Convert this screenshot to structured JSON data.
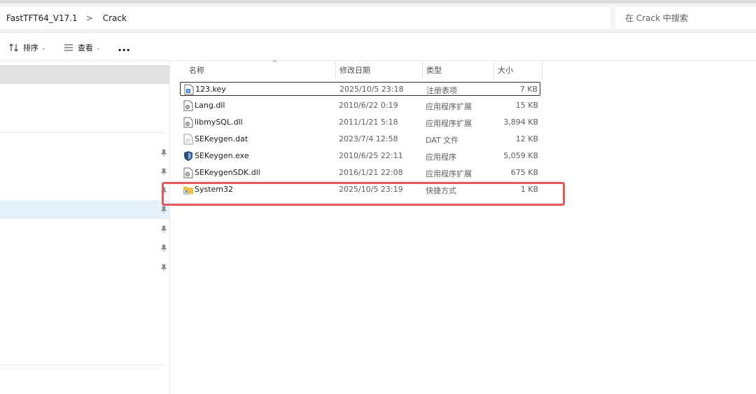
{
  "address": {
    "breadcrumb": [
      "FastTFT64_V17.1",
      "Crack"
    ],
    "separator": ">",
    "search_placeholder": "在 Crack 中搜索"
  },
  "toolbar": {
    "sort_label": "排序",
    "view_label": "查看",
    "more_label": "..."
  },
  "columns": {
    "name": "名称",
    "date": "修改日期",
    "type": "类型",
    "size": "大小"
  },
  "files": [
    {
      "name": "123.key",
      "date": "2025/10/5 23:18",
      "type": "注册表项",
      "size": "7 KB",
      "icon": "registry-file-icon"
    },
    {
      "name": "Lang.dll",
      "date": "2010/6/22 0:19",
      "type": "应用程序扩展",
      "size": "15 KB",
      "icon": "dll-file-icon"
    },
    {
      "name": "libmySQL.dll",
      "date": "2011/1/21 5:18",
      "type": "应用程序扩展",
      "size": "3,894 KB",
      "icon": "dll-file-icon"
    },
    {
      "name": "SEKeygen.dat",
      "date": "2023/7/4 12:58",
      "type": "DAT 文件",
      "size": "12 KB",
      "icon": "dat-file-icon"
    },
    {
      "name": "SEKeygen.exe",
      "date": "2010/6/25 22:11",
      "type": "应用程序",
      "size": "5,059 KB",
      "icon": "exe-shield-icon"
    },
    {
      "name": "SEKeygenSDK.dll",
      "date": "2016/1/21 22:08",
      "type": "应用程序扩展",
      "size": "675 KB",
      "icon": "dll-file-icon"
    },
    {
      "name": "System32",
      "date": "2025/10/5 23:19",
      "type": "快捷方式",
      "size": "1 KB",
      "icon": "folder-shortcut-icon"
    }
  ],
  "colors": {
    "highlight_box": "#e35a5a",
    "sidebar_selected": "#e0e0e0",
    "sidebar_hover": "#e5f1fb",
    "folder_yellow": "#f5c343",
    "exe_blue": "#2f4f7f"
  }
}
